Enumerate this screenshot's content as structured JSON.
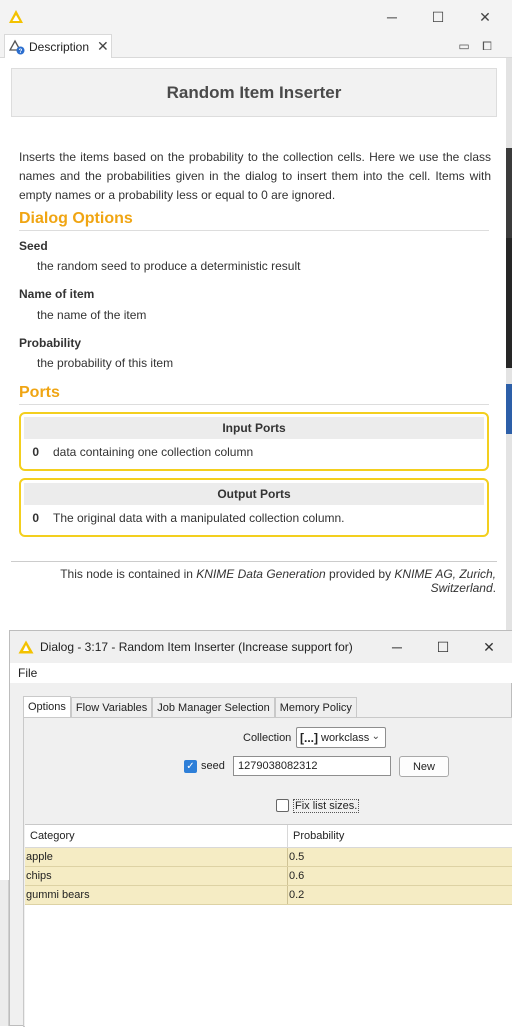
{
  "description_window": {
    "tab_label": "Description",
    "node_name": "Random Item Inserter",
    "intro": "Inserts the items based on the probability to the collection cells. Here we use the class names and the probabilities given in the dialog to insert them into the cell. Items with empty names or a probability less or equal to 0 are ignored.",
    "dialog_options_heading": "Dialog Options",
    "options": [
      {
        "name": "Seed",
        "description": "the random seed to produce a deterministic result"
      },
      {
        "name": "Name of item",
        "description": "the name of the item"
      },
      {
        "name": "Probability",
        "description": "the probability of this item"
      }
    ],
    "ports_heading": "Ports",
    "input_ports": {
      "title": "Input Ports",
      "rows": [
        {
          "index": "0",
          "text": "data containing one collection column"
        }
      ]
    },
    "output_ports": {
      "title": "Output Ports",
      "rows": [
        {
          "index": "0",
          "text": "The original data with a manipulated collection column."
        }
      ]
    },
    "footer": {
      "prefix": "This node is contained in ",
      "extension": "KNIME Data Generation",
      "middle": " provided by ",
      "vendor": "KNIME AG, Zurich, Switzerland",
      "suffix": "."
    },
    "window_controls": {
      "minimize": "─",
      "maximize": "☐",
      "close": "✕"
    },
    "view_controls": {
      "minimize": "▭",
      "maximize": "⧠"
    },
    "tab_close": "✕"
  },
  "dialog": {
    "title": "Dialog - 3:17 - Random Item Inserter  (Increase support for)",
    "menu": [
      "File"
    ],
    "tabs": [
      {
        "label": "Options",
        "active": true
      },
      {
        "label": "Flow Variables",
        "active": false
      },
      {
        "label": "Job Manager Selection",
        "active": false
      },
      {
        "label": "Memory Policy",
        "active": false
      }
    ],
    "collection_label": "Collection",
    "collection_prefix": "[...]",
    "collection_value": "workclass",
    "seed_label": "seed",
    "seed_checked": true,
    "seed_value": "1279038082312",
    "new_button": "New",
    "fix_list_sizes_label": "Fix list sizes.",
    "fix_list_sizes_checked": false,
    "table": {
      "columns": [
        "Category",
        "Probability"
      ],
      "rows": [
        [
          "apple",
          "0.5"
        ],
        [
          "chips",
          "0.6"
        ],
        [
          "gummi bears",
          "0.2"
        ]
      ]
    },
    "window_controls": {
      "minimize": "─",
      "maximize": "☐",
      "close": "✕"
    }
  },
  "colors": {
    "accent_orange": "#f0a513",
    "port_border": "#f3cf1e",
    "row_highlight": "#f5ecc4",
    "checkbox_blue": "#2e7fd8"
  }
}
